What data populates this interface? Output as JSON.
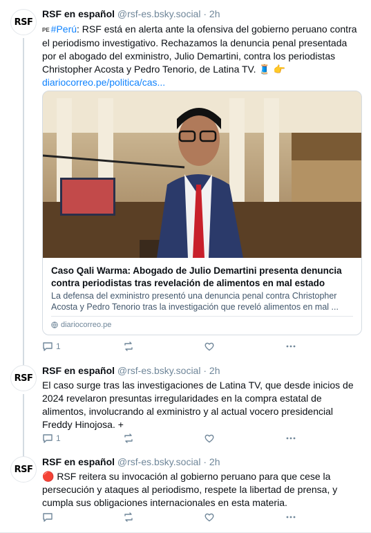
{
  "colors": {
    "accent": "#1083fe",
    "muted": "#6f8699",
    "text": "#0b0f14"
  },
  "posts": [
    {
      "avatar_text": "RSF",
      "author": "RSF en español",
      "handle": "@rsf-es.bsky.social",
      "dot": "·",
      "time": "2h",
      "flag": "PE",
      "hashtag": "#Perú",
      "body": ": RSF está en alerta ante la ofensiva del gobierno peruano contra el periodismo investigativo. Rechazamos la denuncia penal presentada por el abogado del exministro, Julio Demartini, contra los periodistas Christopher Acosta y Pedro Tenorio, de Latina TV. 🧵 👉",
      "link": "diariocorreo.pe/politica/cas...",
      "card": {
        "title": "Caso Qali Warma: Abogado de Julio Demartini presenta denuncia contra periodistas tras revelación de alimentos en mal estado",
        "description": "La defensa del exministro presentó una denuncia penal contra Christopher Acosta y Pedro Tenorio tras la investigación que reveló alimentos en mal ...",
        "domain": "diariocorreo.pe"
      },
      "reply_count": "1",
      "repost_count": "",
      "like_count": ""
    },
    {
      "avatar_text": "RSF",
      "author": "RSF en español",
      "handle": "@rsf-es.bsky.social",
      "dot": "·",
      "time": "2h",
      "body": "El caso surge tras las investigaciones de Latina TV, que desde inicios de 2024 revelaron presuntas irregularidades en la compra estatal de alimentos, involucrando al exministro y al actual vocero presidencial Freddy Hinojosa. +",
      "reply_count": "1",
      "repost_count": "",
      "like_count": ""
    },
    {
      "avatar_text": "RSF",
      "author": "RSF en español",
      "handle": "@rsf-es.bsky.social",
      "dot": "·",
      "time": "2h",
      "body": "🔴 RSF reitera su invocación al gobierno peruano para que cese la persecución y ataques al periodismo, respete la libertad de prensa, y cumpla sus obligaciones internacionales en esta materia.",
      "reply_count": "",
      "repost_count": "",
      "like_count": ""
    }
  ]
}
